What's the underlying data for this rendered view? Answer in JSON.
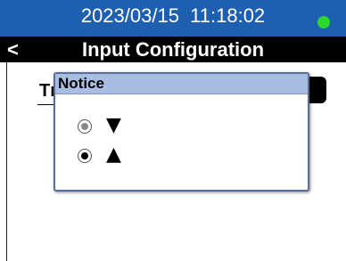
{
  "status_bar": {
    "datetime": "2023/03/15  11:18:02",
    "indicator_color": "#2cd82c"
  },
  "header": {
    "back_label": "<",
    "title": "Input Configuration"
  },
  "background_form": {
    "field_label": "Tı"
  },
  "dialog": {
    "title": "Notice",
    "options": [
      {
        "glyph": "▼",
        "selected": false
      },
      {
        "glyph": "▲",
        "selected": true
      }
    ]
  }
}
